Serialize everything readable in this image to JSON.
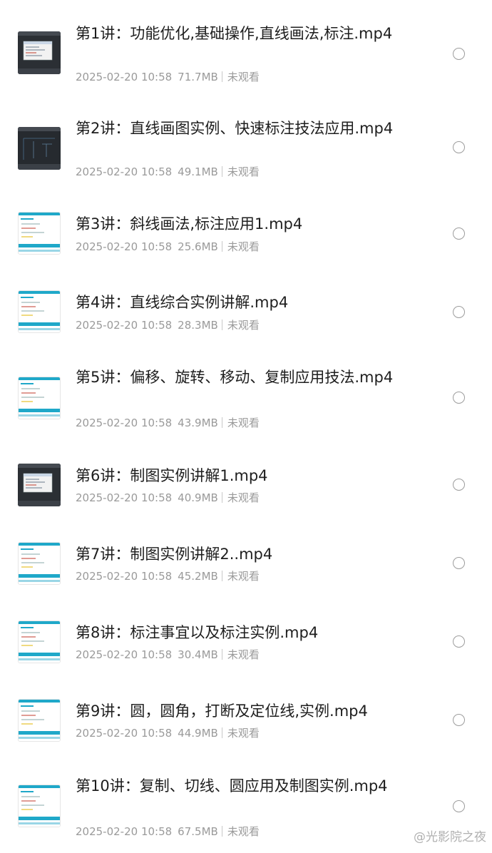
{
  "files": [
    {
      "name": "第1讲：功能优化,基础操作,直线画法,标注.mp4",
      "date": "2025-02-20 10:58",
      "size": "71.7MB",
      "status": "未观看",
      "thumb": "dark-cad-dialog"
    },
    {
      "name": "第2讲：直线画图实例、快速标注技法应用.mp4",
      "date": "2025-02-20 10:58",
      "size": "49.1MB",
      "status": "未观看",
      "thumb": "dark-cad-drawing"
    },
    {
      "name": "第3讲：斜线画法,标注应用1.mp4",
      "date": "2025-02-20 10:58",
      "size": "25.6MB",
      "status": "未观看",
      "thumb": "light-slide"
    },
    {
      "name": "第4讲：直线综合实例讲解.mp4",
      "date": "2025-02-20 10:58",
      "size": "28.3MB",
      "status": "未观看",
      "thumb": "light-slide"
    },
    {
      "name": "第5讲：偏移、旋转、移动、复制应用技法.mp4",
      "date": "2025-02-20 10:58",
      "size": "43.9MB",
      "status": "未观看",
      "thumb": "light-slide"
    },
    {
      "name": "第6讲：制图实例讲解1.mp4",
      "date": "2025-02-20 10:58",
      "size": "40.9MB",
      "status": "未观看",
      "thumb": "dark-cad-dialog"
    },
    {
      "name": "第7讲：制图实例讲解2..mp4",
      "date": "2025-02-20 10:58",
      "size": "45.2MB",
      "status": "未观看",
      "thumb": "light-slide"
    },
    {
      "name": "第8讲：标注事宜以及标注实例.mp4",
      "date": "2025-02-20 10:58",
      "size": "30.4MB",
      "status": "未观看",
      "thumb": "light-slide"
    },
    {
      "name": "第9讲：圆，圆角，打断及定位线,实例.mp4",
      "date": "2025-02-20 10:58",
      "size": "44.9MB",
      "status": "未观看",
      "thumb": "light-slide"
    },
    {
      "name": "第10讲：复制、切线、圆应用及制图实例.mp4",
      "date": "2025-02-20 10:58",
      "size": "67.5MB",
      "status": "未观看",
      "thumb": "light-slide"
    }
  ],
  "watermark": "@光影院之夜"
}
